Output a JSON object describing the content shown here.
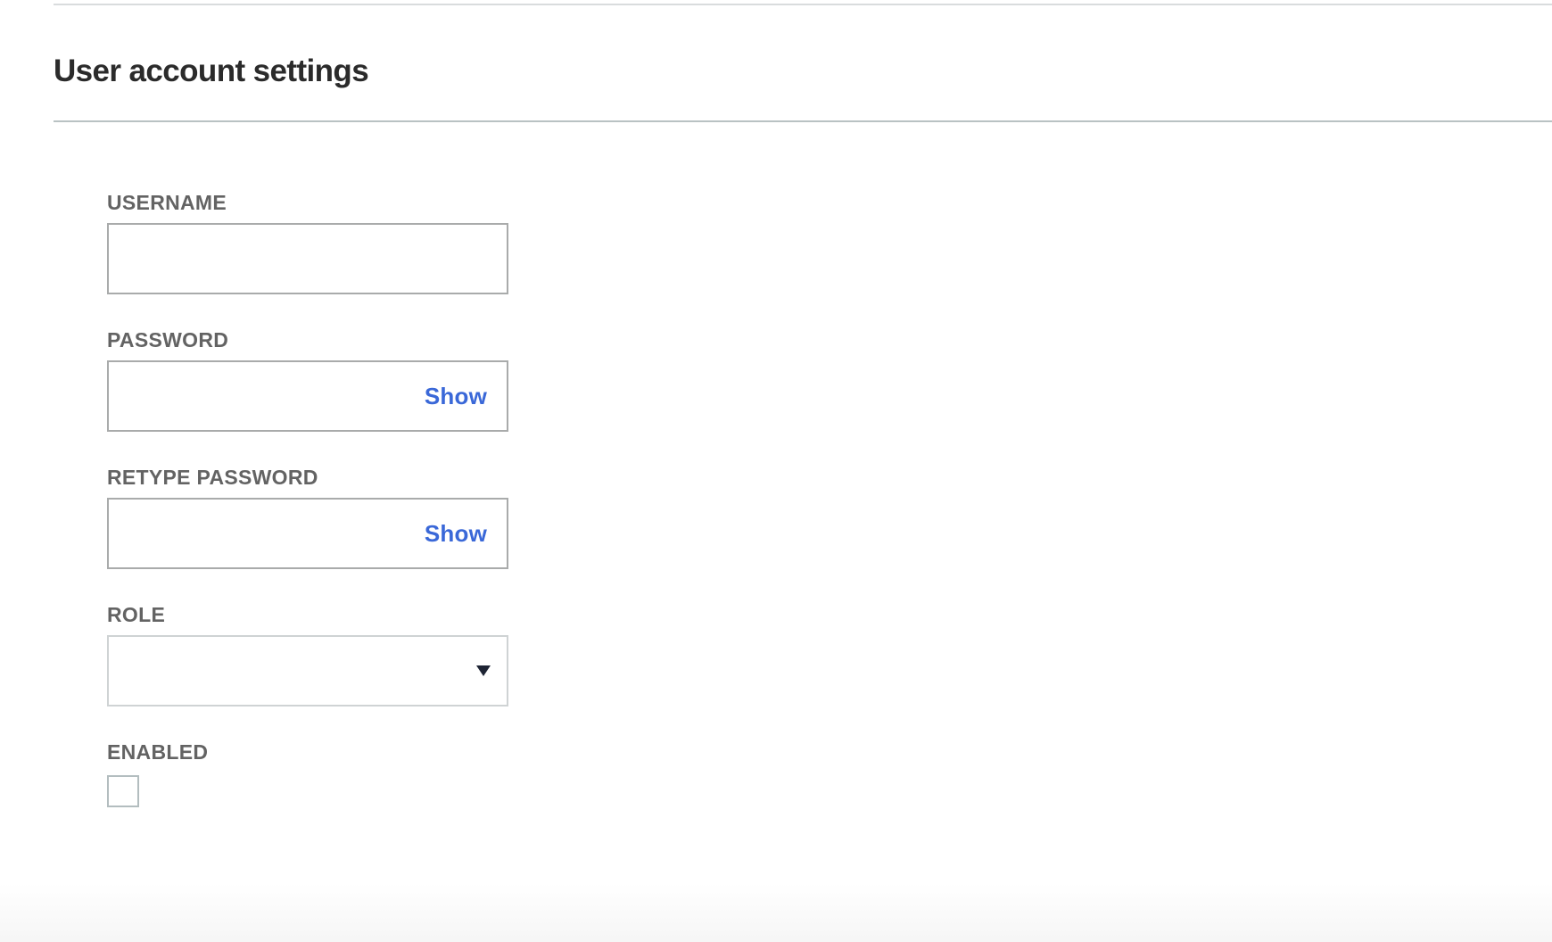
{
  "page": {
    "title": "User account settings"
  },
  "form": {
    "username": {
      "label": "USERNAME",
      "value": "",
      "placeholder": ""
    },
    "password": {
      "label": "PASSWORD",
      "value": "",
      "placeholder": "",
      "toggle_label": "Show"
    },
    "retype_password": {
      "label": "RETYPE PASSWORD",
      "value": "",
      "placeholder": "",
      "toggle_label": "Show"
    },
    "role": {
      "label": "ROLE",
      "selected": "",
      "icon": "caret-down-icon"
    },
    "enabled": {
      "label": "ENABLED",
      "checked": false
    }
  },
  "colors": {
    "link": "#3a68d8",
    "label": "#636363",
    "title": "#2b2b2b",
    "input_border": "#a9abab",
    "divider": "#b9c2c3"
  }
}
